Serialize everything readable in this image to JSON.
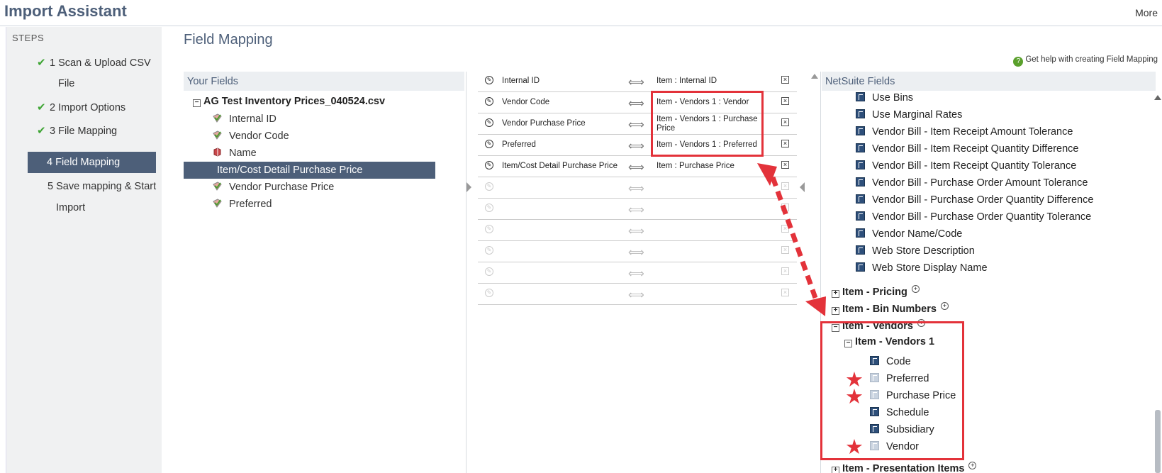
{
  "header": {
    "title": "Import Assistant",
    "more": "More"
  },
  "steps": {
    "header": "STEPS",
    "items": [
      {
        "line1": "1 Scan & Upload CSV",
        "line2": "File",
        "done": true
      },
      {
        "line1": "2 Import Options",
        "done": true
      },
      {
        "line1": "3 File Mapping",
        "done": true
      },
      {
        "line1": "4 Field Mapping",
        "active": true
      },
      {
        "line1": "5 Save mapping & Start",
        "line2": "Import"
      }
    ],
    "check": "✔"
  },
  "main": {
    "title": "Field Mapping",
    "help": "Get help with creating Field Mapping"
  },
  "your_fields": {
    "header": "Your Fields",
    "file": "AG Test Inventory Prices_040524.csv",
    "items": [
      "Internal ID",
      "Vendor Code",
      "Name",
      "Item/Cost Detail Purchase Price",
      "Vendor Purchase Price",
      "Preferred"
    ]
  },
  "mappings": [
    {
      "src": "Internal ID",
      "dst": "Item : Internal ID"
    },
    {
      "src": "Vendor Code",
      "dst": "Item - Vendors 1 : Vendor"
    },
    {
      "src": "Vendor Purchase Price",
      "dst": "Item - Vendors 1 : Purchase Price"
    },
    {
      "src": "Preferred",
      "dst": "Item - Vendors 1 : Preferred"
    },
    {
      "src": "Item/Cost Detail Purchase Price",
      "dst": "Item : Purchase Price"
    }
  ],
  "netsuite_fields": {
    "header": "NetSuite Fields",
    "items": [
      "Use Bins",
      "Use Marginal Rates",
      "Vendor Bill - Item Receipt Amount Tolerance",
      "Vendor Bill - Item Receipt Quantity Difference",
      "Vendor Bill - Item Receipt Quantity Tolerance",
      "Vendor Bill - Purchase Order Amount Tolerance",
      "Vendor Bill - Purchase Order Quantity Difference",
      "Vendor Bill - Purchase Order Quantity Tolerance",
      "Vendor Name/Code",
      "Web Store Description",
      "Web Store Display Name"
    ],
    "groups": [
      "Item - Pricing",
      "Item - Bin Numbers",
      "Item - Vendors"
    ],
    "subgroup": "Item - Vendors 1",
    "sub_items": [
      "Code",
      "Preferred",
      "Purchase Price",
      "Schedule",
      "Subsidiary",
      "Vendor"
    ],
    "last_group": "Item - Presentation Items"
  },
  "colors": {
    "accent": "#4d5f79",
    "annotation": "#e3323a",
    "check": "#3fa535"
  }
}
